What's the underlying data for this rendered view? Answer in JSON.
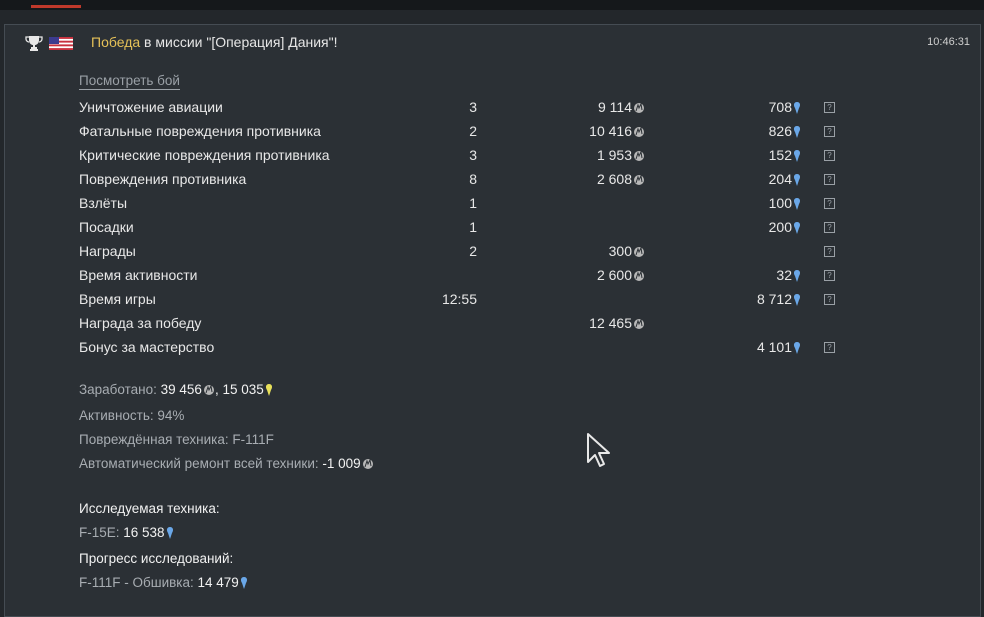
{
  "header": {
    "victory_word": "Победа",
    "mission_text": " в миссии \"[Операция] Дания\"!",
    "time": "10:46:31"
  },
  "watch_link": "Посмотреть бой",
  "rows": [
    {
      "label": "Уничтожение авиации",
      "count": "3",
      "silver": "9 114",
      "rp": "708",
      "help": "?"
    },
    {
      "label": "Фатальные повреждения противника",
      "count": "2",
      "silver": "10 416",
      "rp": "826",
      "help": "?"
    },
    {
      "label": "Критические повреждения противника",
      "count": "3",
      "silver": "1 953",
      "rp": "152",
      "help": "?"
    },
    {
      "label": "Повреждения противника",
      "count": "8",
      "silver": "2 608",
      "rp": "204",
      "help": "?"
    },
    {
      "label": "Взлёты",
      "count": "1",
      "silver": "",
      "rp": "100",
      "help": "?"
    },
    {
      "label": "Посадки",
      "count": "1",
      "silver": "",
      "rp": "200",
      "help": "?"
    },
    {
      "label": "Награды",
      "count": "2",
      "silver": "300",
      "rp": "",
      "help": "?"
    },
    {
      "label": "Время активности",
      "count": "",
      "silver": "2 600",
      "rp": "32",
      "help": "?"
    },
    {
      "label": "Время игры",
      "count": "12:55",
      "silver": "",
      "rp": "8 712",
      "help": "?"
    },
    {
      "label": "Награда за победу",
      "count": "",
      "silver": "12 465",
      "rp": "",
      "help": ""
    },
    {
      "label": "Бонус за мастерство",
      "count": "",
      "silver": "",
      "rp": "4 101",
      "help": "?"
    }
  ],
  "summary": {
    "earned_label": "Заработано: ",
    "earned_silver": "39 456",
    "earned_sep": ", ",
    "earned_rp": "15 035",
    "activity": "Активность: 94%",
    "damaged": "Повреждённая техника: F-111F",
    "repair_label": "Автоматический ремонт всей техники: ",
    "repair_value": "-1 009"
  },
  "research": {
    "heading": "Исследуемая техника:",
    "vehicle_label": "F-15E: ",
    "vehicle_value": "16 538",
    "progress_heading": "Прогресс исследований:",
    "module_label": "F-111F - Обшивка: ",
    "module_value": "14 479"
  },
  "icons": {
    "silver": "silver-lion-icon",
    "rp": "research-point-icon",
    "free_rp": "free-research-point-icon",
    "trophy": "trophy-icon",
    "flag": "usa-flag-icon",
    "cursor": "mouse-cursor-icon"
  },
  "colors": {
    "victory": "#e5c158",
    "rp_blue": "#6aa7e8",
    "free_rp_yellow": "#e8e05a",
    "silver": "#c8c8c8"
  }
}
